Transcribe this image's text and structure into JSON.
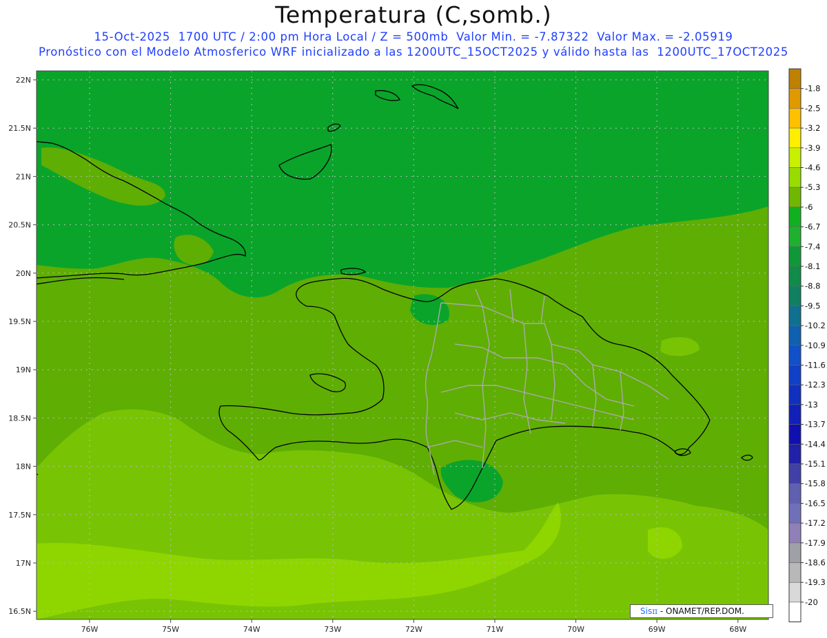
{
  "header": {
    "title": "Temperatura (C,somb.)",
    "subtitle_line1": "15-Oct-2025  1700 UTC / 2:00 pm Hora Local / Z = 500mb  Valor Min. = -7.87322  Valor Max. = -2.05919",
    "subtitle_line2": "Pronóstico con el Modelo Atmosferico WRF inicializado a las 1200UTC_15OCT2025 y válido hasta las  1200UTC_17OCT2025"
  },
  "map": {
    "lat_labels": [
      "22N",
      "21.5N",
      "21N",
      "20.5N",
      "20N",
      "19.5N",
      "19N",
      "18.5N",
      "18N",
      "17.5N",
      "17N",
      "16.5N"
    ],
    "lon_labels": [
      "76W",
      "75W",
      "74W",
      "73W",
      "72W",
      "71W",
      "70W",
      "69W",
      "68W"
    ],
    "region": "Hispaniola / Caribbean",
    "colors": {
      "band_-6.7": "#0aa42a",
      "band_-6": "#5fae04",
      "band_-5.3": "#78c404",
      "band_-4.6": "#8fd600",
      "coastline": "#000000",
      "provinces": "#aaaaaa",
      "grid": "#bbbbbb"
    }
  },
  "colorbar": {
    "levels": [
      "-1.8",
      "-2.5",
      "-3.2",
      "-3.9",
      "-4.6",
      "-5.3",
      "-6",
      "-6.7",
      "-7.4",
      "-8.1",
      "-8.8",
      "-9.5",
      "-10.2",
      "-10.9",
      "-11.6",
      "-12.3",
      "-13",
      "-13.7",
      "-14.4",
      "-15.1",
      "-15.8",
      "-16.5",
      "-17.2",
      "-17.9",
      "-18.6",
      "-19.3",
      "-20"
    ],
    "colors": [
      "#c08000",
      "#e09a00",
      "#ffc000",
      "#ffee00",
      "#c8f000",
      "#98dc00",
      "#70b800",
      "#10b020",
      "#20b030",
      "#109838",
      "#108c48",
      "#108060",
      "#107090",
      "#1060b0",
      "#1050c8",
      "#1040c8",
      "#1030c0",
      "#1020b8",
      "#1010b0",
      "#2020a8",
      "#4040a8",
      "#6060b0",
      "#7070b8",
      "#9080b8",
      "#a0a0a8",
      "#b8b8b8",
      "#d8d8d8",
      "#ffffff"
    ]
  },
  "credit": {
    "sis": "Sis",
    "pi": "π",
    "org": " - ONAMET/REP.DOM."
  }
}
